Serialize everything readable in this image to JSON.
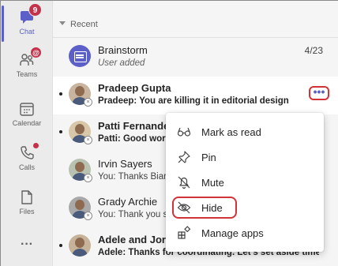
{
  "rail": {
    "items": [
      {
        "label": "Chat",
        "badge": "9",
        "active": true
      },
      {
        "label": "Teams",
        "badge": "@"
      },
      {
        "label": "Calendar"
      },
      {
        "label": "Calls",
        "dot": true
      },
      {
        "label": "Files"
      }
    ],
    "more": "···"
  },
  "list": {
    "section": "Recent",
    "rows": [
      {
        "name": "Brainstorm",
        "preview": "User added",
        "time": "4/23"
      },
      {
        "name": "Pradeep Gupta",
        "preview": "Pradeep: You are killing it in editorial design"
      },
      {
        "name": "Patti Fernandez",
        "preview": "Patti: Good work"
      },
      {
        "name": "Irvin Sayers",
        "preview": "You: Thanks Bianca"
      },
      {
        "name": "Grady Archie",
        "preview": "You: Thank you so much"
      },
      {
        "name": "Adele and Jordan",
        "preview": "Adele: Thanks for coordinating. Let's set aside time"
      }
    ],
    "more_button": "•••"
  },
  "menu": {
    "items": [
      {
        "label": "Mark as read",
        "icon": "glasses-icon"
      },
      {
        "label": "Pin",
        "icon": "pin-icon"
      },
      {
        "label": "Mute",
        "icon": "bell-off-icon"
      },
      {
        "label": "Hide",
        "icon": "eye-off-icon"
      },
      {
        "label": "Manage apps",
        "icon": "apps-icon"
      }
    ]
  },
  "colors": {
    "accent": "#5b5fc7",
    "highlight": "#d13438",
    "badge": "#c4314b"
  }
}
